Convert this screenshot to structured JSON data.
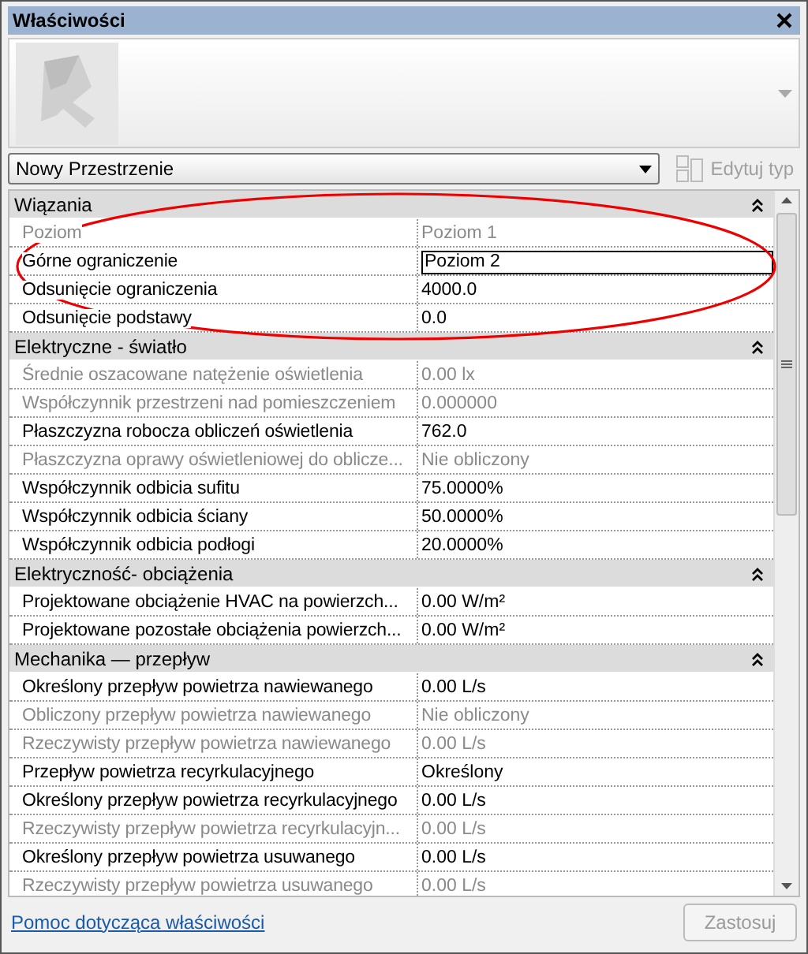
{
  "window": {
    "title": "Właściwości"
  },
  "type_selector": {
    "value": "Nowy Przestrzenie"
  },
  "edit_type_button": {
    "label": "Edytuj typ",
    "disabled": true
  },
  "sections": [
    {
      "title": "Wiązania",
      "expanded": true,
      "rows": [
        {
          "label": "Poziom",
          "value": "Poziom 1",
          "disabled": true,
          "editing": false
        },
        {
          "label": "Górne ograniczenie",
          "value": "Poziom 2",
          "disabled": false,
          "editing": true
        },
        {
          "label": "Odsunięcie ograniczenia",
          "value": "4000.0",
          "disabled": false,
          "editing": false
        },
        {
          "label": "Odsunięcie podstawy",
          "value": "0.0",
          "disabled": false,
          "editing": false
        }
      ]
    },
    {
      "title": "Elektryczne - światło",
      "expanded": true,
      "rows": [
        {
          "label": "Średnie oszacowane natężenie oświetlenia",
          "value": "0.00 lx",
          "disabled": true,
          "editing": false
        },
        {
          "label": "Współczynnik przestrzeni nad pomieszczeniem",
          "value": "0.000000",
          "disabled": true,
          "editing": false
        },
        {
          "label": "Płaszczyzna robocza obliczeń oświetlenia",
          "value": "762.0",
          "disabled": false,
          "editing": false
        },
        {
          "label": "Płaszczyzna oprawy oświetleniowej do oblicze...",
          "value": "Nie obliczony",
          "disabled": true,
          "editing": false
        },
        {
          "label": "Współczynnik odbicia sufitu",
          "value": "75.0000%",
          "disabled": false,
          "editing": false
        },
        {
          "label": "Współczynnik odbicia ściany",
          "value": "50.0000%",
          "disabled": false,
          "editing": false
        },
        {
          "label": "Współczynnik odbicia podłogi",
          "value": "20.0000%",
          "disabled": false,
          "editing": false
        }
      ]
    },
    {
      "title": "Elektryczność- obciążenia",
      "expanded": true,
      "rows": [
        {
          "label": "Projektowane obciążenie HVAC na powierzch...",
          "value": "0.00 W/m²",
          "disabled": false,
          "editing": false
        },
        {
          "label": "Projektowane pozostałe obciążenia powierzch...",
          "value": "0.00 W/m²",
          "disabled": false,
          "editing": false
        }
      ]
    },
    {
      "title": "Mechanika — przepływ",
      "expanded": true,
      "rows": [
        {
          "label": "Określony przepływ powietrza nawiewanego",
          "value": "0.00 L/s",
          "disabled": false,
          "editing": false
        },
        {
          "label": "Obliczony przepływ powietrza nawiewanego",
          "value": "Nie obliczony",
          "disabled": true,
          "editing": false
        },
        {
          "label": "Rzeczywisty przepływ powietrza nawiewanego",
          "value": "0.00 L/s",
          "disabled": true,
          "editing": false
        },
        {
          "label": "Przepływ powietrza recyrkulacyjnego",
          "value": "Określony",
          "disabled": false,
          "editing": false
        },
        {
          "label": "Określony przepływ powietrza recyrkulacyjnego",
          "value": "0.00 L/s",
          "disabled": false,
          "editing": false
        },
        {
          "label": "Rzeczywisty przepływ powietrza recyrkulacyjn...",
          "value": "0.00 L/s",
          "disabled": true,
          "editing": false
        },
        {
          "label": "Określony przepływ powietrza usuwanego",
          "value": "0.00 L/s",
          "disabled": false,
          "editing": false
        },
        {
          "label": "Rzeczywisty przepływ powietrza usuwanego",
          "value": "0.00 L/s",
          "disabled": true,
          "editing": false
        }
      ]
    }
  ],
  "help_link": "Pomoc dotycząca właściwości",
  "apply_button": {
    "label": "Zastosuj",
    "disabled": true
  }
}
